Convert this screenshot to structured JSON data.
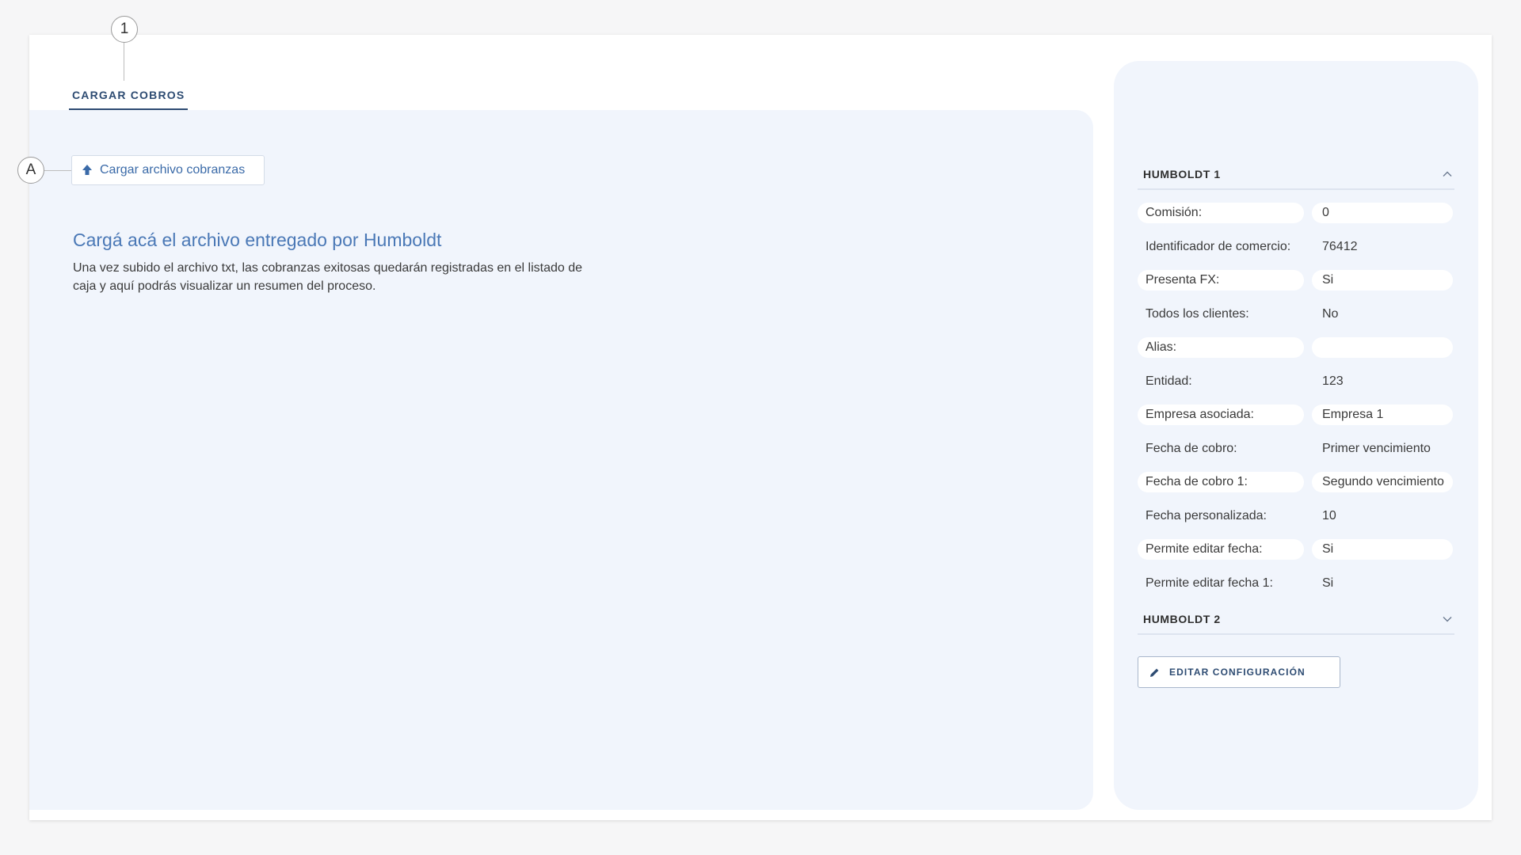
{
  "markers": {
    "step": "1",
    "annotation": "A"
  },
  "tabs": [
    {
      "label": "CARGAR COBROS"
    }
  ],
  "upload": {
    "button_label": "Cargar archivo cobranzas",
    "icon": "upload-arrow-icon"
  },
  "intro": {
    "headline": "Cargá acá el archivo entregado por Humboldt",
    "description": "Una vez subido el archivo txt, las cobranzas exitosas quedarán registradas en el listado de caja y aquí podrás visualizar un resumen del proceso."
  },
  "config": {
    "sections": [
      {
        "title": "HUMBOLDT 1",
        "expanded": true,
        "icon": "chevron-up-icon",
        "fields": [
          {
            "label": "Comisión:",
            "value": "0"
          },
          {
            "label": "Identificador de comercio:",
            "value": "76412"
          },
          {
            "label": "Presenta FX:",
            "value": "Si"
          },
          {
            "label": "Todos los clientes:",
            "value": "No"
          },
          {
            "label": "Alias:",
            "value": ""
          },
          {
            "label": "Entidad:",
            "value": "123"
          },
          {
            "label": "Empresa asociada:",
            "value": "Empresa 1"
          },
          {
            "label": "Fecha de cobro:",
            "value": "Primer vencimiento"
          },
          {
            "label": "Fecha de cobro 1:",
            "value": "Segundo vencimiento"
          },
          {
            "label": "Fecha personalizada:",
            "value": "10"
          },
          {
            "label": "Permite editar fecha:",
            "value": "Si"
          },
          {
            "label": "Permite editar fecha 1:",
            "value": "Si"
          }
        ]
      },
      {
        "title": "HUMBOLDT 2",
        "expanded": false,
        "icon": "chevron-down-icon"
      }
    ],
    "edit_button_label": "EDITAR CONFIGURACIÓN",
    "edit_icon": "pencil-icon"
  },
  "colors": {
    "accent": "#2d4b72",
    "link": "#4a78b6",
    "panel_bg": "#f1f5fc",
    "page_bg": "#f6f6f7"
  }
}
